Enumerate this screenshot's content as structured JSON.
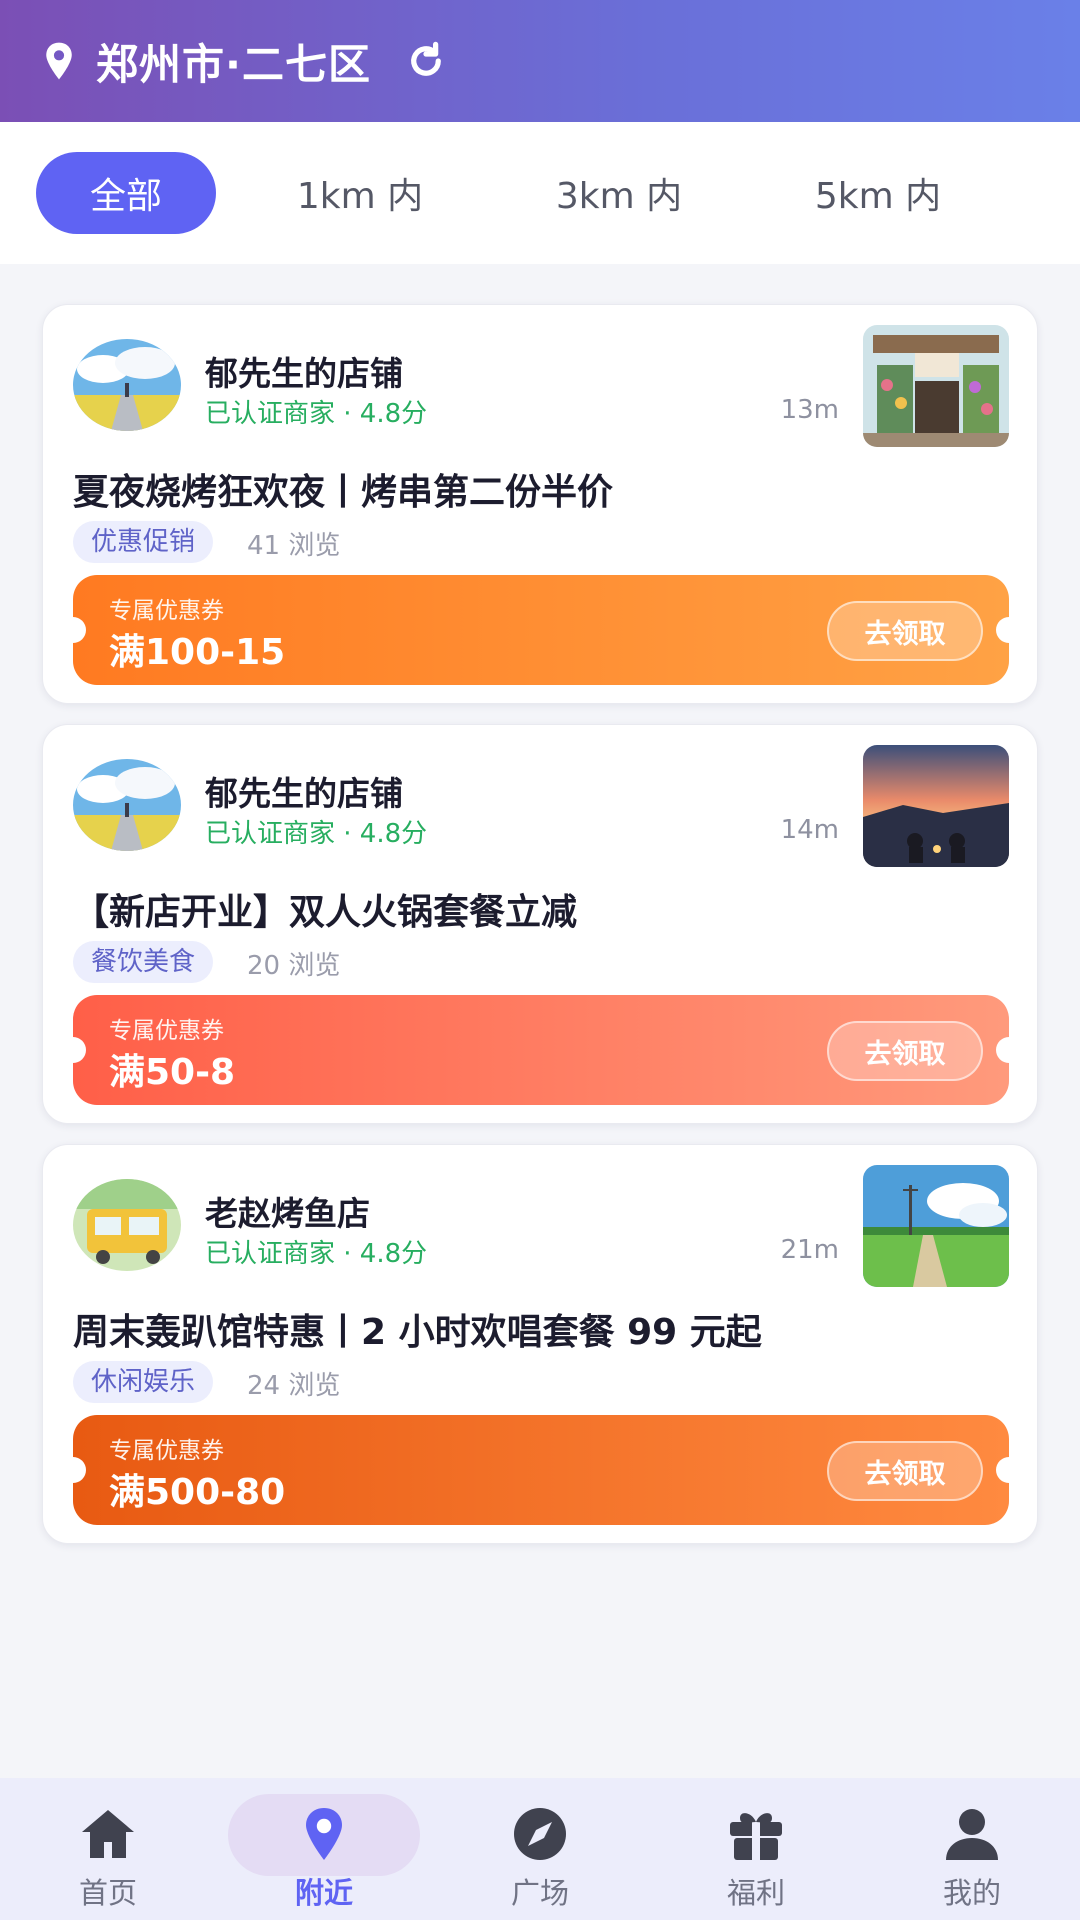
{
  "header": {
    "location": "郑州市·二七区"
  },
  "filters": [
    {
      "label": "全部",
      "active": true
    },
    {
      "label": "1km 内",
      "active": false
    },
    {
      "label": "3km 内",
      "active": false
    },
    {
      "label": "5km 内",
      "active": false
    }
  ],
  "cards": [
    {
      "shop": "郁先生的店铺",
      "verified": "已认证商家 · 4.8分",
      "distance": "13m",
      "title": "夏夜烧烤狂欢夜丨烤串第二份半价",
      "tag": "优惠促销",
      "views": "41 浏览",
      "coupon_label": "专属优惠券",
      "coupon_value": "满100-15",
      "claim": "去领取",
      "coupon_color_from": "#ff7a21",
      "coupon_color_to": "#ffa245"
    },
    {
      "shop": "郁先生的店铺",
      "verified": "已认证商家 · 4.8分",
      "distance": "14m",
      "title": "【新店开业】双人火锅套餐立减",
      "tag": "餐饮美食",
      "views": "20 浏览",
      "coupon_label": "专属优惠券",
      "coupon_value": "满50-8",
      "claim": "去领取",
      "coupon_color_from": "#ff5f48",
      "coupon_color_to": "#ff9a7c"
    },
    {
      "shop": "老赵烤鱼店",
      "verified": "已认证商家 · 4.8分",
      "distance": "21m",
      "title": "周末轰趴馆特惠丨2 小时欢唱套餐 99 元起",
      "tag": "休闲娱乐",
      "views": "24 浏览",
      "coupon_label": "专属优惠券",
      "coupon_value": "满500-80",
      "claim": "去领取",
      "coupon_color_from": "#e85a12",
      "coupon_color_to": "#ff8a40"
    }
  ],
  "nav": [
    {
      "label": "首页",
      "icon": "home-icon",
      "active": false
    },
    {
      "label": "附近",
      "icon": "location-pin-icon",
      "active": true
    },
    {
      "label": "广场",
      "icon": "compass-icon",
      "active": false
    },
    {
      "label": "福利",
      "icon": "gift-icon",
      "active": false
    },
    {
      "label": "我的",
      "icon": "user-icon",
      "active": false
    }
  ],
  "colors": {
    "accent": "#5f63f3",
    "verified": "#27ae60",
    "header_from": "#7b4fb5",
    "header_to": "#6a80e8"
  }
}
